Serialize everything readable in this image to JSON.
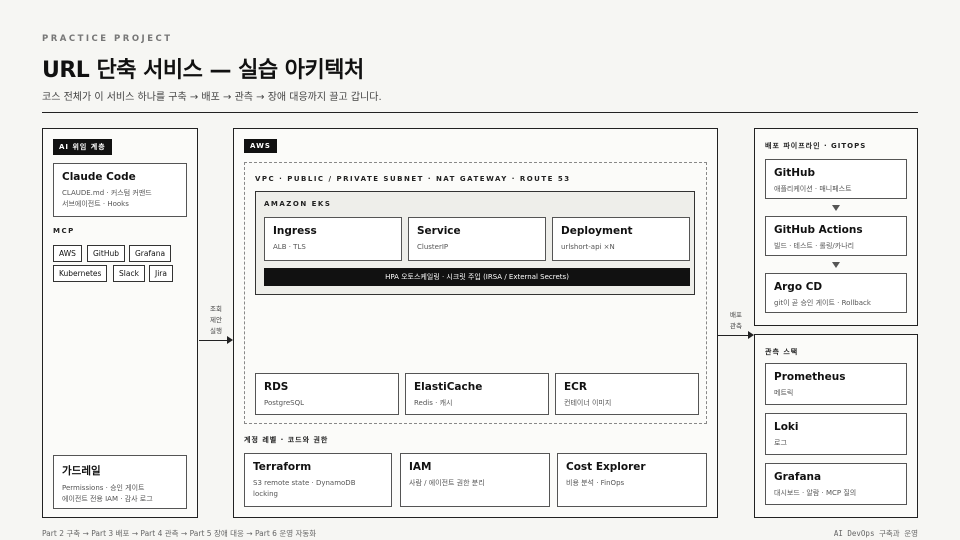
{
  "header": {
    "eyebrow": "PRACTICE PROJECT",
    "title": "URL 단축 서비스 — 실습 아키텍처",
    "subtitle": "코스 전체가 이 서비스 하나를 구축 → 배포 → 관측 → 장애 대응까지 끌고 갑니다."
  },
  "ai": {
    "tag": "AI 위임 계층",
    "claude": {
      "title": "Claude Code",
      "sub": "CLAUDE.md · 커스텀 커맨드\n서브에이전트 · Hooks"
    },
    "mcp_label": "MCP",
    "mcp_chips": [
      "AWS",
      "GitHub",
      "Grafana",
      "Kubernetes",
      "Slack",
      "Jira"
    ],
    "guard": {
      "title": "가드레일",
      "sub": "Permissions · 승인 게이트\n에이전트 전용 IAM · 감사 로그"
    }
  },
  "conn_left": "조회\n제안\n실행",
  "aws": {
    "tag": "AWS",
    "vpc_label": "VPC · PUBLIC / PRIVATE SUBNET · NAT GATEWAY · ROUTE 53",
    "eks_label": "AMAZON EKS",
    "eks_cards": [
      {
        "title": "Ingress",
        "sub": "ALB · TLS"
      },
      {
        "title": "Service",
        "sub": "ClusterIP"
      },
      {
        "title": "Deployment",
        "sub": "urlshort-api ×N"
      }
    ],
    "hpa": "HPA 오토스케일링 · 시크릿 주입 (IRSA / External Secrets)",
    "data_cards": [
      {
        "title": "RDS",
        "sub": "PostgreSQL"
      },
      {
        "title": "ElastiCache",
        "sub": "Redis · 캐시"
      },
      {
        "title": "ECR",
        "sub": "컨테이너 이미지"
      }
    ],
    "account_label": "계정 레벨 · 코드와 권한",
    "account_cards": [
      {
        "title": "Terraform",
        "sub": "S3 remote state · DynamoDB\nlocking"
      },
      {
        "title": "IAM",
        "sub": "사람 / 에이전트 권한 분리"
      },
      {
        "title": "Cost Explorer",
        "sub": "비용 분석 · FinOps"
      }
    ]
  },
  "conn_right": "배포\n관측",
  "pipeline": {
    "label": "배포 파이프라인 · GITOPS",
    "cards": [
      {
        "title": "GitHub",
        "sub": "애플리케이션 · 매니페스트"
      },
      {
        "title": "GitHub Actions",
        "sub": "빌드 · 테스트 · 롤링/카나리"
      },
      {
        "title": "Argo CD",
        "sub": "git이 곧 승인 게이트 · Rollback"
      }
    ]
  },
  "observe": {
    "label": "관측 스택",
    "cards": [
      {
        "title": "Prometheus",
        "sub": "메트릭"
      },
      {
        "title": "Loki",
        "sub": "로그"
      },
      {
        "title": "Grafana",
        "sub": "대시보드 · 알람 · MCP 질의"
      }
    ]
  },
  "footer": {
    "left": "Part 2 구축 → Part 3 배포 → Part 4 관측 → Part 5 장애 대응 → Part 6 운영 자동화",
    "right": "AI DevOps 구축과 운영"
  }
}
